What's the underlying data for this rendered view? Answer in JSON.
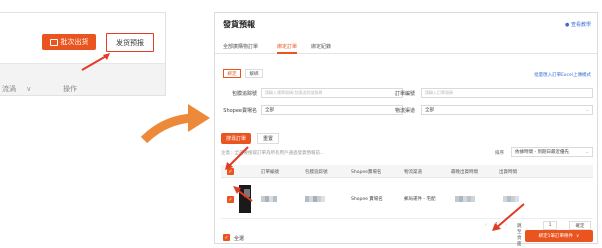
{
  "left_screenshot": {
    "batch_ship_label": "批次出货",
    "ship_notice_label": "发货预报",
    "column1_label": "流渦",
    "column2_label": "操作"
  },
  "panel": {
    "title": "發貨預報",
    "help_link": "● 查看教學",
    "tabs": [
      {
        "label": "全部廣購物訂單",
        "active": false
      },
      {
        "label": "綁定訂單",
        "active": true
      },
      {
        "label": "綁定紀錄",
        "active": false
      }
    ],
    "mode_chips": [
      {
        "label": "綁定",
        "active": true
      },
      {
        "label": "解綁",
        "active": false
      }
    ],
    "excel_link": "批量匯入訂單Excel上傳模式",
    "filters": {
      "logistics_no_label": "包膜追踪號",
      "logistics_no_placeholder": "請輸入運單號碼/包膜追踪號搜尋",
      "order_no_label": "訂單編號",
      "order_no_placeholder": "請輸入訂單號碼",
      "shop_label": "Shopee賣場名",
      "shop_value": "全部",
      "channel_label": "物流渠道",
      "channel_value": "全部"
    },
    "search_button": "搜尋訂單",
    "reset_button": "重置",
    "note": "注意：全選要搜取訂單為所有用戶通過發貨預報前...",
    "sort_label": "排序",
    "sort_value": "依據時間 - 到期日最近優先",
    "table": {
      "headers": [
        "訂單編號",
        "包膜追踪號",
        "Shopee賣場名",
        "物流渠道",
        "最晚出貨時間",
        "出貨時間"
      ],
      "row": {
        "shop": "Shopee 賣場名",
        "channel": "郵局運件 - 宅配"
      }
    },
    "pagination": {
      "current_page": "1",
      "goto_label": "跳至頁面",
      "page_input": "1",
      "confirm": "確定"
    },
    "select_all_label": "全選",
    "generate_button": "綁定1筆訂單條件"
  },
  "colors": {
    "accent": "#e9541f",
    "highlight_red": "#e23b26",
    "big_arrow": "#ed8a3a",
    "link_blue": "#3a6fd8"
  }
}
